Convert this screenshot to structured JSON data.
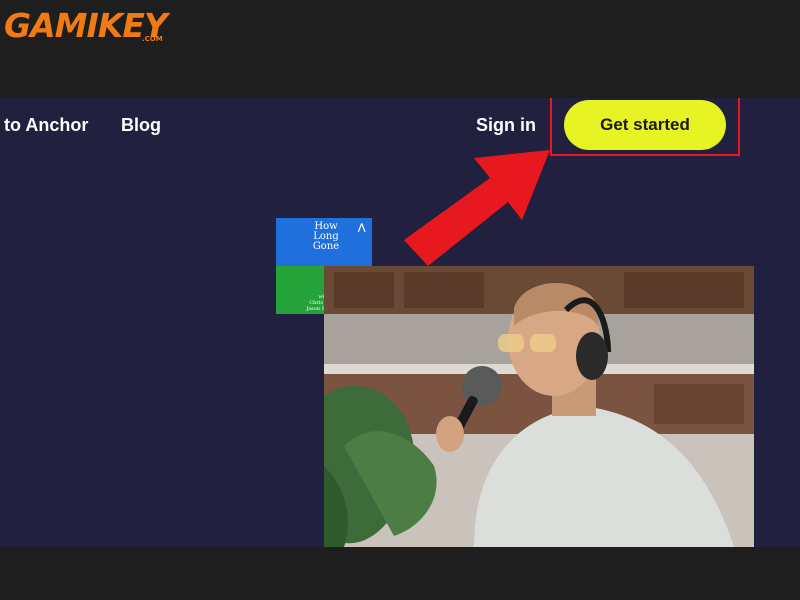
{
  "watermark": {
    "brand": "GAMIKEY",
    "suffix": ".COM"
  },
  "nav": {
    "welcome_label": "to Anchor",
    "blog_label": "Blog",
    "signin_label": "Sign in",
    "cta_label": "Get started"
  },
  "podcast_cover": {
    "title": "How Long Gone",
    "credit_line1": "with",
    "credit_line2": "Chris Black",
    "credit_line3": "Jason Stewart"
  },
  "colors": {
    "page_bg": "#22203f",
    "frame_bg": "#1e1e1e",
    "cta_bg": "#e7f323",
    "highlight": "#e8181f",
    "watermark": "#f07a14"
  }
}
